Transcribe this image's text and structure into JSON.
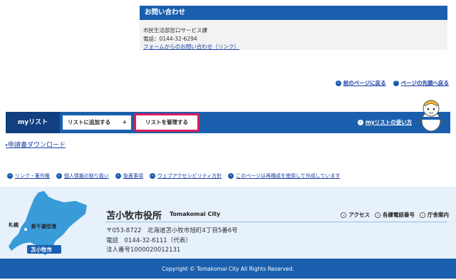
{
  "contact": {
    "heading": "お問い合わせ",
    "dept": "市民生活部窓口サービス課",
    "phone": "電話：0144-32-6294",
    "form_link": "フォームからのお問い合わせ（リンク）"
  },
  "page_nav": {
    "back": "前のページに戻る",
    "top": "ページの先頭へ戻る"
  },
  "mylist": {
    "title": "myリスト",
    "add_button": "リストに追加する",
    "add_plus": "+",
    "manage_button": "リストを管理する",
    "howto": "myリストの使い方"
  },
  "download_link": "申請書ダウンロード",
  "footer_links": [
    "リンク・著作権",
    "個人情報の取り扱い",
    "免責事項",
    "ウェブアクセシビリティ方針",
    "このページは再構成を使用して作成しています"
  ],
  "map": {
    "sapporo": "札幌",
    "airport": "新千歳空港",
    "city_tag": "苫小牧市"
  },
  "city": {
    "name_ja": "苫小牧市役所",
    "name_en": "Tomakomai City",
    "postal": "〒053-8722　北海道苫小牧市旭町4丁目5番6号",
    "phone": "電話　0144-32-6111（代表）",
    "corp_no": "法人番号1000020012131"
  },
  "footer_nav": [
    "アクセス",
    "各課電話番号",
    "庁舎案内"
  ],
  "copyright": "Copyright © Tomakomai City All Rights Reserved.",
  "colors": {
    "primary": "#1a5fad",
    "dark": "#113f80",
    "highlight": "#d81e5b",
    "footer_bg": "#e6f1fb",
    "hokkaido": "#3a9bd9"
  }
}
